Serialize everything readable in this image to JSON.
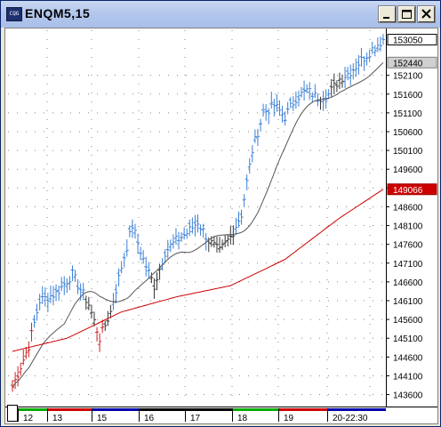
{
  "window": {
    "title": "ENQM5,15",
    "app_icon_text": "CQG",
    "controls": [
      "minimize",
      "maximize",
      "close"
    ]
  },
  "price_axis": {
    "labels": [
      "152100",
      "151600",
      "151100",
      "150600",
      "150100",
      "149600",
      "149100",
      "148600",
      "148100",
      "147600",
      "147100",
      "146600",
      "146100",
      "145600",
      "145100",
      "144600",
      "144100",
      "143600"
    ],
    "label_values": [
      152100,
      151600,
      151100,
      150600,
      150100,
      149600,
      149100,
      148600,
      148100,
      147600,
      147100,
      146600,
      146100,
      145600,
      145100,
      144600,
      144100,
      143600
    ],
    "last_price_tag": "153050",
    "fast_ma_tag": "152440",
    "slow_ma_tag": "149066",
    "colors": {
      "last_price_tag": "#000000",
      "fast_ma_tag": "#000000",
      "slow_ma_tag": "#cc0000"
    }
  },
  "time_axis": {
    "labels": [
      "12",
      "13",
      "15",
      "16",
      "17",
      "18",
      "19",
      "20-22:30"
    ],
    "session_colors": [
      "#00aa00",
      "#cc0000",
      "#0000aa",
      "#000000",
      "#000000",
      "#00aa00",
      "#cc0000",
      "#0000aa"
    ]
  },
  "colors": {
    "bar_up": "#3a7fd5",
    "bar_neutral": "#333333",
    "bar_down": "#cc2222",
    "fast_ma": "#555555",
    "slow_ma": "#cc0000",
    "grid_dots": "#888888"
  },
  "chart_data": {
    "type": "bar",
    "title": "ENQM5,15",
    "ylim": [
      143400,
      153300
    ],
    "x_sessions": [
      "12",
      "13",
      "15",
      "16",
      "17",
      "18",
      "19",
      "20"
    ],
    "series": [
      {
        "name": "ENQM5",
        "kind": "price_bars",
        "waypoints": [
          [
            0,
            143800
          ],
          [
            6,
            144900
          ],
          [
            10,
            146100
          ],
          [
            16,
            146300
          ],
          [
            22,
            146800
          ],
          [
            28,
            146000
          ],
          [
            32,
            145100
          ],
          [
            36,
            145800
          ],
          [
            40,
            147000
          ],
          [
            44,
            148100
          ],
          [
            48,
            147200
          ],
          [
            52,
            146500
          ],
          [
            56,
            147400
          ],
          [
            60,
            147700
          ],
          [
            64,
            147900
          ],
          [
            68,
            148200
          ],
          [
            72,
            147700
          ],
          [
            76,
            147400
          ],
          [
            80,
            147800
          ],
          [
            84,
            148400
          ],
          [
            88,
            150100
          ],
          [
            92,
            151100
          ],
          [
            96,
            151300
          ],
          [
            100,
            151000
          ],
          [
            104,
            151500
          ],
          [
            108,
            151700
          ],
          [
            112,
            151500
          ],
          [
            116,
            151600
          ],
          [
            120,
            152000
          ],
          [
            124,
            152200
          ],
          [
            128,
            152500
          ],
          [
            132,
            152800
          ],
          [
            136,
            153050
          ]
        ]
      },
      {
        "name": "Fast MA",
        "value_tag": 152440
      },
      {
        "name": "Slow MA",
        "value_tag": 149066
      }
    ]
  }
}
